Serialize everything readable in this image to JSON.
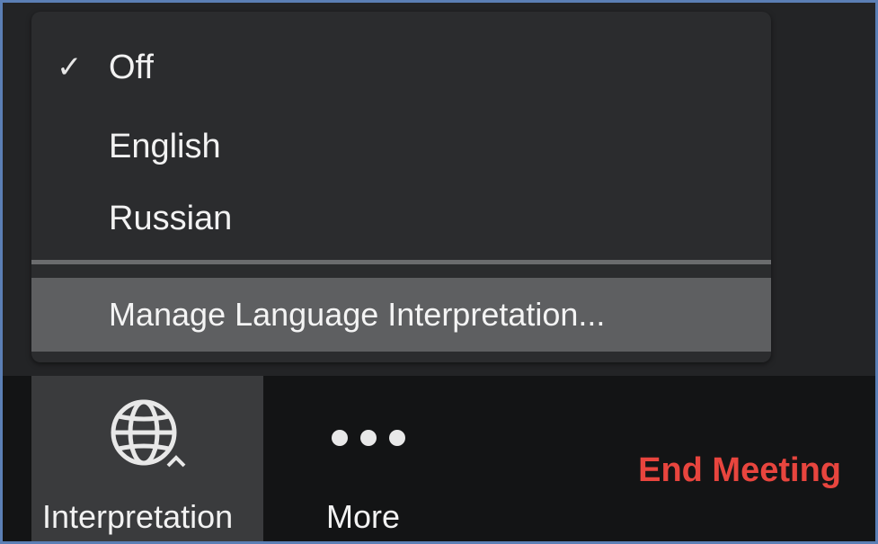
{
  "menu": {
    "items": [
      {
        "label": "Off",
        "checked": true
      },
      {
        "label": "English",
        "checked": false
      },
      {
        "label": "Russian",
        "checked": false
      }
    ],
    "check_glyph": "✓",
    "manage_label": "Manage Language Interpretation..."
  },
  "toolbar": {
    "interpretation": {
      "label": "Interpretation",
      "icon": "globe-icon"
    },
    "more": {
      "label": "More",
      "icon": "ellipsis-icon"
    },
    "end_meeting_label": "End Meeting"
  },
  "colors": {
    "end_meeting": "#e8453e",
    "menu_bg": "#2b2c2e",
    "highlight": "#5e5f61",
    "toolbar_bg": "#131415"
  }
}
